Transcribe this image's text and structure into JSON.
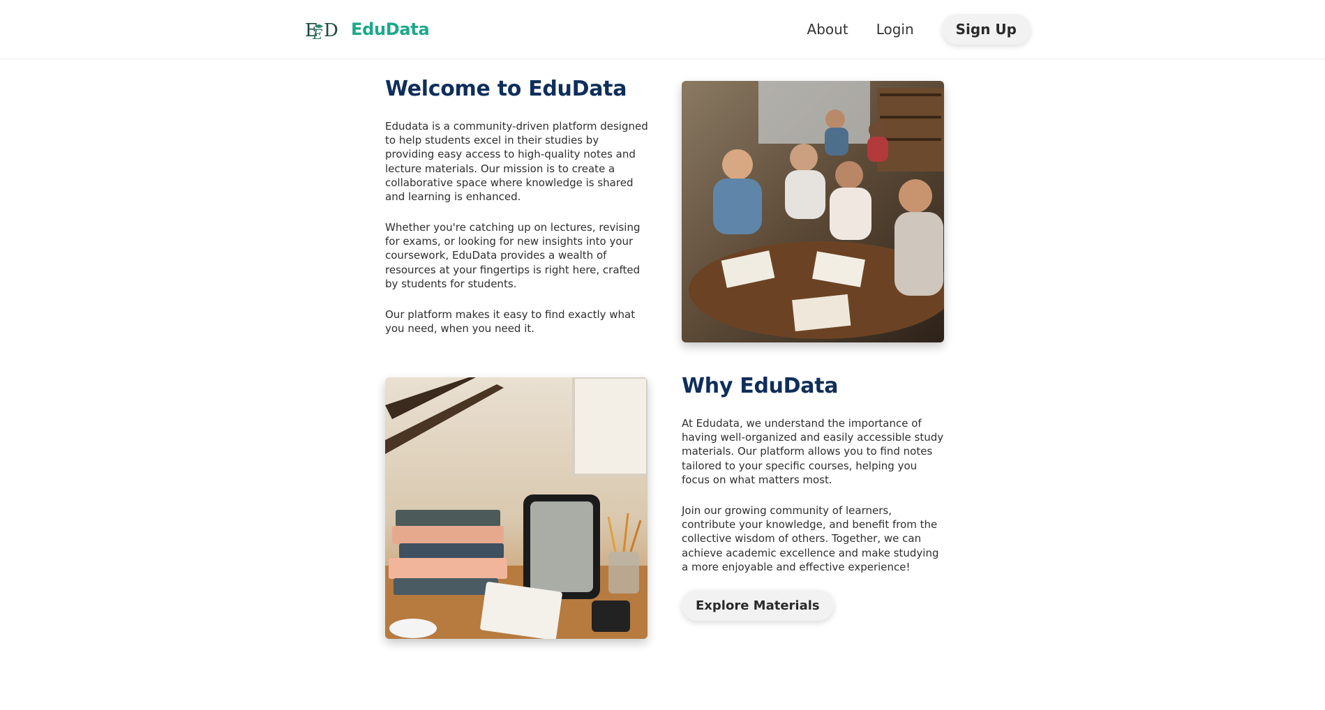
{
  "nav": {
    "brand": "EduData",
    "logo_letters": "EED",
    "links": [
      "About",
      "Login"
    ],
    "signup": "Sign Up"
  },
  "welcome": {
    "title": "Welcome to EduData",
    "paragraphs": [
      "Edudata is a community-driven platform designed to help students excel in their studies by providing easy access to high-quality notes and lecture materials. Our mission is to create a collaborative space where knowledge is shared and learning is enhanced.",
      "Whether you're catching up on lectures, revising for exams, or looking for new insights into your coursework, EduData provides a wealth of resources at your fingertips is right here, crafted by students for students.",
      "Our platform makes it easy to find exactly what you need, when you need it."
    ]
  },
  "why": {
    "title": "Why EduData",
    "paragraphs": [
      "At Edudata, we understand the importance of having well-organized and easily accessible study materials. Our platform allows you to find notes tailored to your specific courses, helping you focus on what matters most.",
      "Join our growing community of learners, contribute your knowledge, and benefit from the collective wisdom of others. Together, we can achieve academic excellence and make studying a more enjoyable and effective experience!"
    ],
    "cta": "Explore Materials"
  },
  "colors": {
    "brand": "#1ba98a",
    "heading": "#0f2e5a",
    "button_bg": "#f2f2f2"
  },
  "icons": {
    "logo": "edudata-logo-icon",
    "photo_students": "students-studying-photo",
    "photo_desk": "desk-books-tablet-photo"
  }
}
